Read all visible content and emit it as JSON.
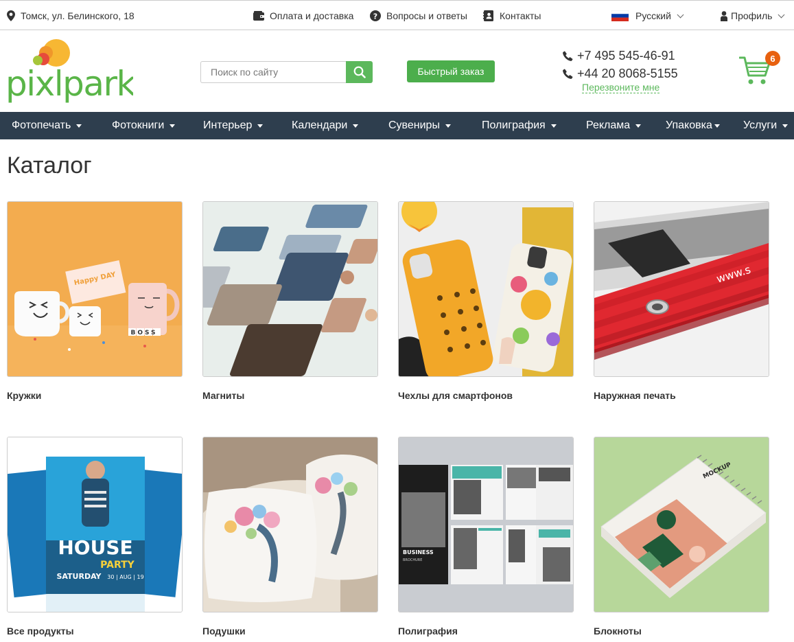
{
  "topbar": {
    "address": "Томск, ул. Белинского, 18",
    "payment": "Оплата и доставка",
    "faq": "Вопросы и ответы",
    "contacts": "Контакты",
    "language": "Русский",
    "profile": "Профиль"
  },
  "header": {
    "search_placeholder": "Поиск по сайту",
    "quick_order": "Быстрый заказ",
    "phone1": "+7 495 545-46-91",
    "phone2": "+44 20 8068-5155",
    "callback": "Перезвоните мне",
    "cart_count": "6"
  },
  "brand": {
    "green": "#5cb85c",
    "nav_bg": "#2e3e4e",
    "badge": "#e8610f"
  },
  "nav": [
    {
      "label": "Фотопечать"
    },
    {
      "label": "Фотокниги"
    },
    {
      "label": "Интерьер"
    },
    {
      "label": "Календари"
    },
    {
      "label": "Сувениры"
    },
    {
      "label": "Полиграфия"
    },
    {
      "label": "Реклама"
    },
    {
      "label": "Упаковка"
    },
    {
      "label": "Услуги"
    }
  ],
  "page_title": "Каталог",
  "catalog": [
    {
      "label": "Кружки"
    },
    {
      "label": "Магниты"
    },
    {
      "label": "Чехлы для смартфонов"
    },
    {
      "label": "Наружная печать"
    },
    {
      "label": "Все продукты"
    },
    {
      "label": "Подушки"
    },
    {
      "label": "Полиграфия"
    },
    {
      "label": "Блокноты"
    }
  ],
  "card_images": {
    "mugs_sign": "Happy DAY",
    "mugs_blocks": "BOSS",
    "flyer_title": "HOUSE",
    "flyer_sub": "PARTY",
    "flyer_day": "SATURDAY",
    "flyer_date": "30 | AUG | 19",
    "brochure_title": "BUSINESS",
    "brochure_sub": "BROCHURE",
    "notebook_title": "MOCKUP",
    "banner_text": "www.s"
  }
}
